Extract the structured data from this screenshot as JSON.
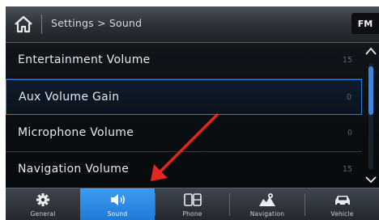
{
  "header": {
    "breadcrumb": "Settings > Sound",
    "source_button": "FM"
  },
  "settings": [
    {
      "label": "Entertainment Volume",
      "value": "15"
    },
    {
      "label": "Aux Volume Gain",
      "value": "0",
      "selected": true
    },
    {
      "label": "Microphone Volume",
      "value": "0"
    },
    {
      "label": "Navigation Volume",
      "value": "15"
    }
  ],
  "tabs": [
    {
      "label": "General",
      "icon": "gear-icon"
    },
    {
      "label": "Sound",
      "icon": "speaker-icon",
      "active": true
    },
    {
      "label": "Phone",
      "icon": "phone-icon"
    },
    {
      "label": "Navigation",
      "icon": "navigation-icon"
    },
    {
      "label": "Vehicle",
      "icon": "car-icon"
    }
  ],
  "colors": {
    "accent": "#2f7bd8",
    "active_tab": "#2a86e3",
    "annotation_arrow": "#e3261f"
  }
}
